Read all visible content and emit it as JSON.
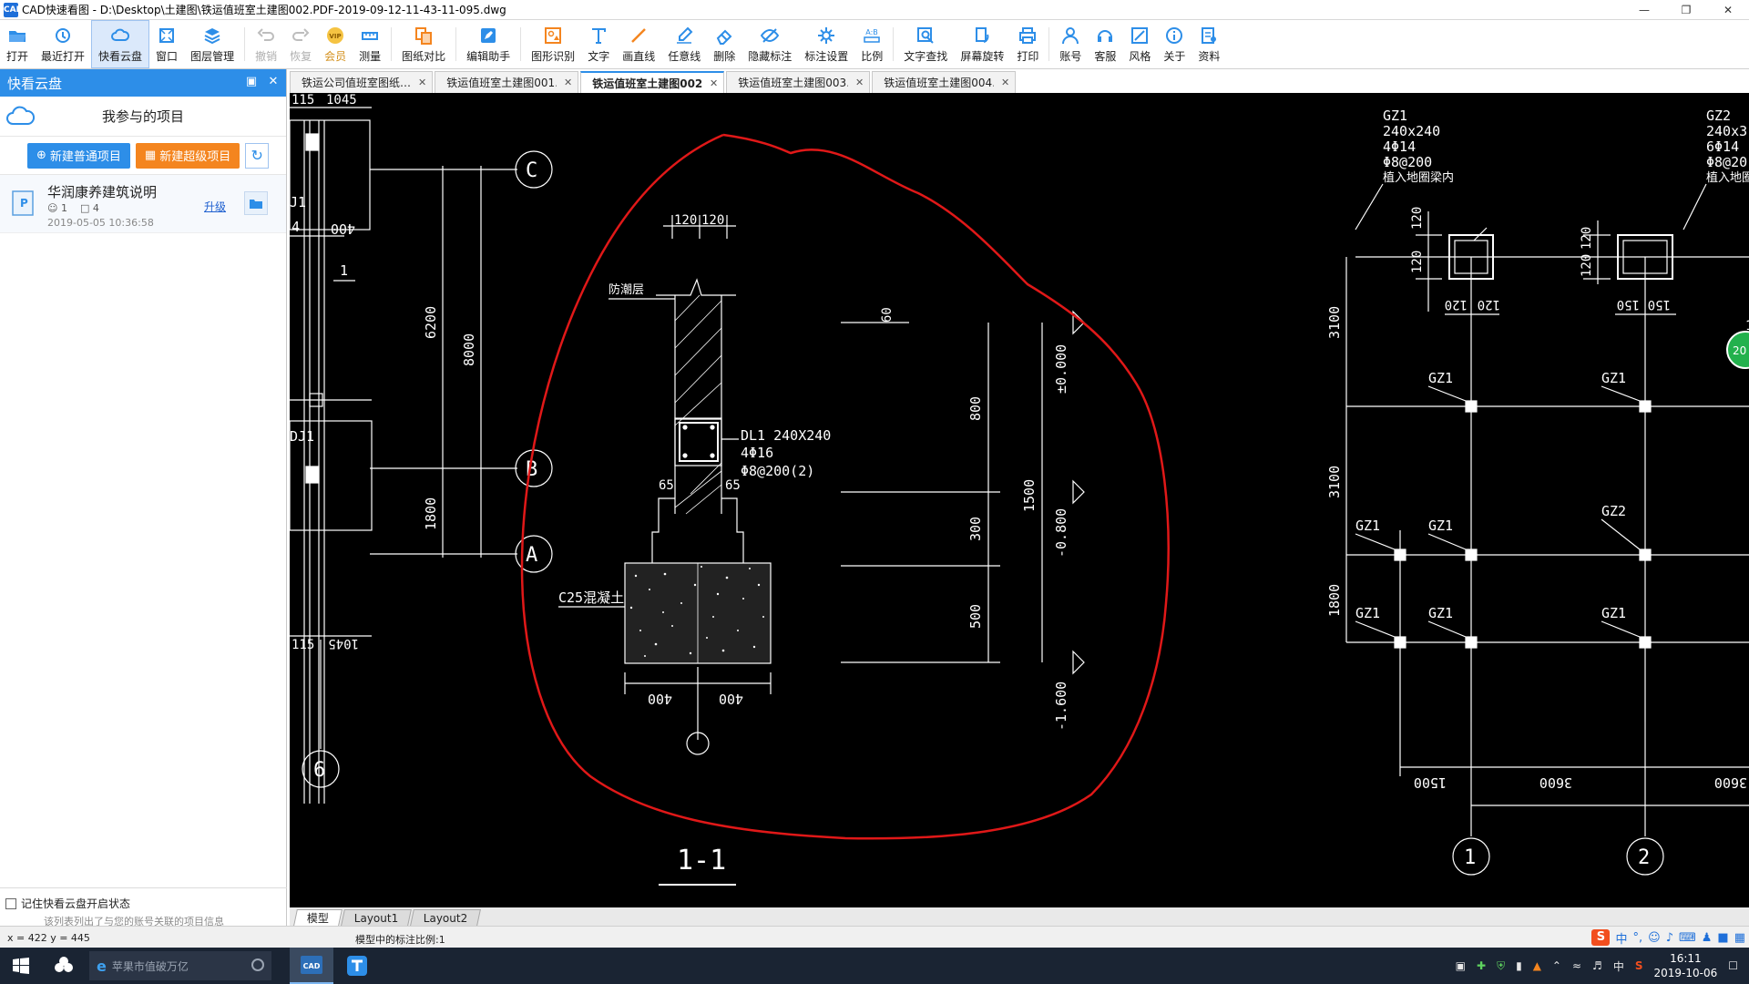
{
  "window": {
    "title": "CAD快速看图 - D:\\Desktop\\土建图\\铁运值班室土建图002.PDF-2019-09-12-11-43-11-095.dwg",
    "app_icon_text": "CAD"
  },
  "toolbar": {
    "items": [
      {
        "label": "打开",
        "icon": "folder-open-icon"
      },
      {
        "label": "最近打开",
        "icon": "history-icon"
      },
      {
        "label": "快看云盘",
        "icon": "cloud-icon"
      },
      {
        "label": "窗口",
        "icon": "window-icon"
      },
      {
        "label": "图层管理",
        "icon": "layers-icon"
      },
      {
        "label": "撤销",
        "icon": "undo-icon"
      },
      {
        "label": "恢复",
        "icon": "redo-icon"
      },
      {
        "label": "会员",
        "icon": "vip-icon"
      },
      {
        "label": "测量",
        "icon": "measure-icon"
      },
      {
        "label": "图纸对比",
        "icon": "compare-icon"
      },
      {
        "label": "编辑助手",
        "icon": "edit-helper-icon"
      },
      {
        "label": "图形识别",
        "icon": "shape-recognize-icon"
      },
      {
        "label": "文字",
        "icon": "text-icon"
      },
      {
        "label": "画直线",
        "icon": "line-icon"
      },
      {
        "label": "任意线",
        "icon": "freehand-icon"
      },
      {
        "label": "删除",
        "icon": "eraser-icon"
      },
      {
        "label": "隐藏标注",
        "icon": "hide-annotation-icon"
      },
      {
        "label": "标注设置",
        "icon": "annotation-settings-icon"
      },
      {
        "label": "比例",
        "icon": "scale-icon"
      },
      {
        "label": "文字查找",
        "icon": "text-search-icon"
      },
      {
        "label": "屏幕旋转",
        "icon": "rotate-screen-icon"
      },
      {
        "label": "打印",
        "icon": "print-icon"
      },
      {
        "label": "账号",
        "icon": "account-icon"
      },
      {
        "label": "客服",
        "icon": "headset-icon"
      },
      {
        "label": "风格",
        "icon": "style-icon"
      },
      {
        "label": "关于",
        "icon": "info-icon"
      },
      {
        "label": "资料",
        "icon": "docs-icon"
      }
    ]
  },
  "sidepanel": {
    "title": "快看云盘",
    "projects_heading": "我参与的项目",
    "btn_new_normal": "新建普通项目",
    "btn_new_super": "新建超级项目",
    "project": {
      "name": "华润康养建筑说明",
      "members": "1",
      "files": "4",
      "date": "2019-05-05 10:36:58",
      "upgrade": "升级"
    },
    "remember_label": "记住快看云盘开启状态",
    "info_text": "该列表列出了与您的账号关联的项目信息"
  },
  "doctabs": [
    {
      "label": "铁运公司值班室图纸…",
      "active": false
    },
    {
      "label": "铁运值班室土建图001…",
      "active": false
    },
    {
      "label": "铁运值班室土建图002…",
      "active": true
    },
    {
      "label": "铁运值班室土建图003…",
      "active": false
    },
    {
      "label": "铁运值班室土建图004…",
      "active": false
    }
  ],
  "layout_tabs": [
    "模型",
    "Layout1",
    "Layout2"
  ],
  "statusbar": {
    "coords": "x = 422  y = 445",
    "scale": "模型中的标注比例:1"
  },
  "taskbar": {
    "search_text": "苹果市值破万亿",
    "time": "16:11",
    "date": "2019-10-06",
    "ime": "中"
  },
  "drawing": {
    "left_dims": [
      "1045",
      "115",
      "400",
      "4",
      "1",
      "J1",
      "DJ1",
      "6200",
      "8000",
      "1800",
      "1045",
      "115"
    ],
    "axis_labels": [
      "C",
      "B",
      "A",
      "6",
      "1",
      "2"
    ],
    "section": {
      "title": "1-1",
      "dim_top": [
        "120",
        "120"
      ],
      "dim_60": "60",
      "moisture_layer": "防潮层",
      "beam_label": "DL1 240X240",
      "beam_rebar": "4Φ16",
      "beam_stirrup": "Φ8@200(2)",
      "dim_65a": "65",
      "dim_65b": "65",
      "concrete": "C25混凝土",
      "dims_right": [
        "800",
        "300",
        "500",
        "1500"
      ],
      "elevations": [
        "±0.000",
        "-0.800",
        "-1.600"
      ],
      "dims_bottom": [
        "400",
        "400"
      ]
    },
    "right_plan": {
      "gz1_note": [
        "GZ1",
        "240x240",
        "4Φ14",
        "Φ8@200",
        "植入地圈梁内"
      ],
      "gz2_note": [
        "GZ2",
        "240x3",
        "6Φ14",
        "Φ8@20",
        "植入地圈"
      ],
      "dims_col": [
        "120",
        "120",
        "120",
        "120",
        "120",
        "150",
        "150",
        "120",
        "120"
      ],
      "dims_left": [
        "3100",
        "3100",
        "1800"
      ],
      "dims_bottom": [
        "1500",
        "3600",
        "3600"
      ],
      "labels": [
        "GZ1",
        "GZ1",
        "GZ1",
        "GZ1",
        "GZ2",
        "GZ1",
        "GZ1",
        "GZ1"
      ],
      "badge": "20"
    }
  },
  "colors": {
    "accent": "#2d8ee8",
    "orange": "#f4851f",
    "cad_bg": "#000000",
    "cad_line": "#ffffff",
    "markup": "#e01818"
  }
}
